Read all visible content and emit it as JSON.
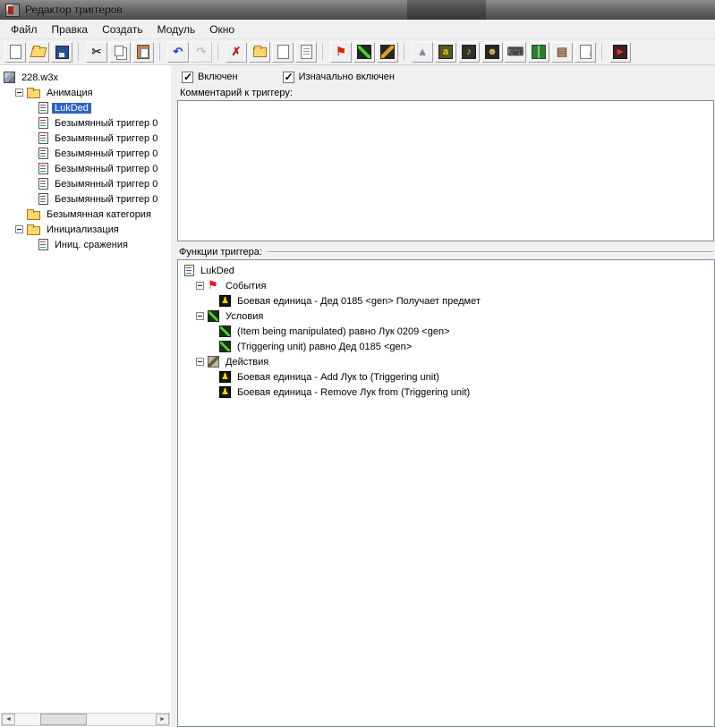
{
  "window": {
    "title": "Редактор триггеров"
  },
  "menubar": {
    "items": [
      "Файл",
      "Правка",
      "Создать",
      "Модуль",
      "Окно"
    ]
  },
  "toolbar": {
    "buttons": [
      {
        "icon": "new-map-icon",
        "shape": "doc"
      },
      {
        "icon": "open-map-icon",
        "shape": "folder-open"
      },
      {
        "icon": "save-map-icon",
        "shape": "save"
      },
      {
        "icon": "cut-icon",
        "glyph": "✂",
        "fg": "#3a3a3a",
        "sep_before": true
      },
      {
        "icon": "copy-icon",
        "shape": "copy"
      },
      {
        "icon": "paste-icon",
        "shape": "paste"
      },
      {
        "icon": "undo-icon",
        "glyph": "↶",
        "fg": "#2244cc",
        "sep_before": true
      },
      {
        "icon": "redo-icon",
        "glyph": "↷",
        "fg": "#999999",
        "disabled": true
      },
      {
        "icon": "delete-icon",
        "glyph": "✗",
        "fg": "#cc1111",
        "sep_before": true
      },
      {
        "icon": "new-category-icon",
        "shape": "folder"
      },
      {
        "icon": "new-trigger-icon",
        "shape": "doc"
      },
      {
        "icon": "new-comment-icon",
        "shape": "doc-lines"
      },
      {
        "icon": "new-event-icon",
        "glyph": "⚑",
        "fg": "#dd2200",
        "sep_before": true
      },
      {
        "icon": "new-condition-icon",
        "shape": "cond"
      },
      {
        "icon": "new-action-icon",
        "shape": "action"
      },
      {
        "icon": "terrain-editor-icon",
        "glyph": "▲",
        "fg": "#7d8da0",
        "sep_before": true
      },
      {
        "icon": "trigger-editor-icon",
        "glyph": "a",
        "fg": "#ffd400",
        "bg": "#565622"
      },
      {
        "icon": "sound-editor-icon",
        "glyph": "♪",
        "fg": "#ffd400",
        "bg": "#303030"
      },
      {
        "icon": "object-editor-icon",
        "glyph": "☻",
        "fg": "#e8b04a",
        "bg": "#262626"
      },
      {
        "icon": "campaign-editor-icon",
        "glyph": "⌨",
        "fg": "#454545"
      },
      {
        "icon": "ai-editor-icon",
        "shape": "ai"
      },
      {
        "icon": "object-manager-icon",
        "glyph": "▤",
        "fg": "#7a5230"
      },
      {
        "icon": "import-manager-icon",
        "shape": "doc-arrow"
      },
      {
        "icon": "test-map-icon",
        "shape": "test",
        "sep_before": true
      }
    ]
  },
  "scrollbar": {
    "left_arrow": "◄",
    "right_arrow": "►"
  },
  "left_tree": {
    "rows": [
      {
        "indent": 0,
        "icon": "map-icon",
        "label": "228.w3x"
      },
      {
        "indent": 1,
        "expander": "minus",
        "icon": "folder-icon",
        "label": "Анимация"
      },
      {
        "indent": 2,
        "icon": "trigger-doc-icon",
        "label": "LukDed",
        "selected": true
      },
      {
        "indent": 2,
        "icon": "trigger-doc-icon",
        "label": "Безымянный триггер 0"
      },
      {
        "indent": 2,
        "icon": "trigger-doc-icon",
        "label": "Безымянный триггер 0"
      },
      {
        "indent": 2,
        "icon": "trigger-doc-icon",
        "label": "Безымянный триггер 0"
      },
      {
        "indent": 2,
        "icon": "trigger-doc-icon",
        "label": "Безымянный триггер 0"
      },
      {
        "indent": 2,
        "icon": "trigger-doc-icon",
        "label": "Безымянный триггер 0"
      },
      {
        "indent": 2,
        "icon": "trigger-doc-icon",
        "label": "Безымянный триггер 0"
      },
      {
        "indent": 1,
        "icon": "folder-icon",
        "label": "Безымянная категория"
      },
      {
        "indent": 1,
        "expander": "minus",
        "icon": "folder-icon",
        "label": "Инициализация"
      },
      {
        "indent": 2,
        "icon": "trigger-doc-icon",
        "label": "Иниц. сражения"
      }
    ]
  },
  "right_panel": {
    "enabled_checkbox_label": "Включен",
    "enabled_checked": true,
    "initially_on_checkbox_label": "Изначально включен",
    "initially_on_checked": true,
    "comment_label": "Комментарий к триггеру:",
    "comment_value": "",
    "functions_label": "Функции триггера:"
  },
  "functions_tree": {
    "rows": [
      {
        "indent": 0,
        "icon": "trigger-doc-icon",
        "label": "LukDed"
      },
      {
        "indent": 1,
        "expander": "minus",
        "icon": "event-flag-icon",
        "label": "События"
      },
      {
        "indent": 2,
        "icon": "unit-event-icon",
        "label": "Боевая единица - Дед 0185 <gen> Получает предмет"
      },
      {
        "indent": 1,
        "expander": "minus",
        "icon": "condition-icon",
        "label": "Условия"
      },
      {
        "indent": 2,
        "icon": "condition-leaf-icon",
        "label": "(Item being manipulated) равно Лук 0209 <gen>"
      },
      {
        "indent": 2,
        "icon": "condition-leaf-icon",
        "label": "(Triggering unit) равно Дед 0185 <gen>"
      },
      {
        "indent": 1,
        "expander": "minus",
        "icon": "action-icon",
        "label": "Действия"
      },
      {
        "indent": 2,
        "icon": "unit-action-icon",
        "label": "Боевая единица - Add Лук to (Triggering unit)"
      },
      {
        "indent": 2,
        "icon": "unit-action-icon",
        "label": "Боевая единица - Remove Лук from (Triggering unit)"
      }
    ]
  }
}
